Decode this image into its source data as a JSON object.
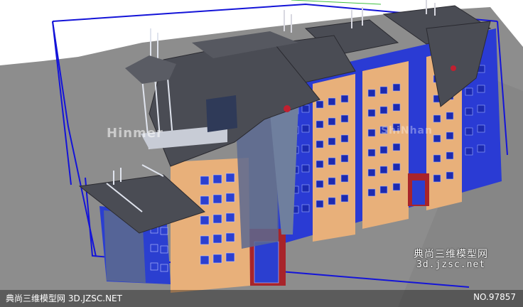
{
  "watermark": {
    "cn_title": "典尚三维模型网",
    "url": "3d.jzsc.net",
    "faint_logo": "Hinmer",
    "faint_logo_2": "ShiNhan"
  },
  "footer": {
    "left_text": "典尚三维模型网 3D.JZSC.NET",
    "right_text": "NO.97857"
  },
  "colors": {
    "ground": "#8a8a8a",
    "sky": "#ffffff",
    "bbox_line": "#1a1ae0",
    "roof": "#4a4c54",
    "wall_orange": "#e8b07a",
    "window_blue": "#2b3fd0",
    "accent_red": "#a8242a"
  }
}
